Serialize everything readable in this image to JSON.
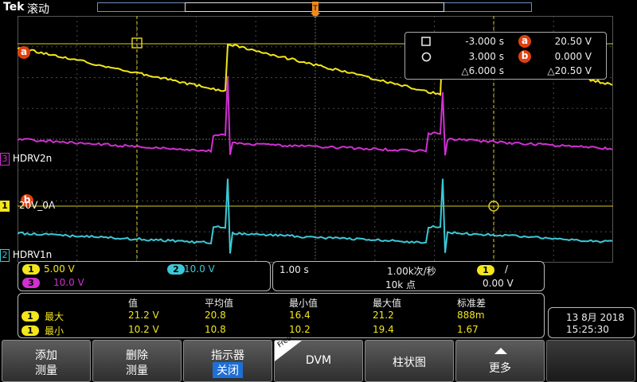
{
  "header": {
    "brand": "Tek",
    "mode": "滚动"
  },
  "channels": {
    "ch1_color": "#f3e61b",
    "ch2_color": "#3cc8d6",
    "ch3_color": "#d030d0",
    "cursor_color": "#e04010"
  },
  "waveform_labels": {
    "ch3_num": "3",
    "ch3_name": "HDRV2n",
    "ch1_num": "1",
    "ch1_name": "20V_0A",
    "ch2_num": "2",
    "ch2_name": "HDRV1n",
    "cursor_a": "a",
    "cursor_b": "b"
  },
  "cursor_readout": {
    "t1": "-3.000 s",
    "t2": "3.000 s",
    "dt": "△6.000 s",
    "a_marker": "a",
    "b_marker": "b",
    "va": "20.50 V",
    "vb": "0.000 V",
    "dv": "△20.50 V"
  },
  "scales": {
    "ch1_num": "1",
    "ch1_scale": "5.00 V",
    "ch2_num": "2",
    "ch2_scale": "10.0 V",
    "ch3_num": "3",
    "ch3_scale": "10.0 V"
  },
  "timebase": {
    "time_div": "1.00 s",
    "sample_rate": "1.00k次/秒",
    "record_length": "10k 点",
    "trigger_source": "1",
    "trigger_slope": "/",
    "trigger_level": "0.00 V"
  },
  "measurements": {
    "headers": [
      "值",
      "平均值",
      "最小值",
      "最大值",
      "标准差"
    ],
    "rows": [
      {
        "ch": "1",
        "name": "最大",
        "values": [
          "21.2 V",
          "20.8",
          "16.4",
          "21.2",
          "888m"
        ]
      },
      {
        "ch": "1",
        "name": "最小",
        "values": [
          "10.2 V",
          "10.8",
          "10.2",
          "19.4",
          "1.67"
        ]
      }
    ]
  },
  "datetime": {
    "date": "13 8月 2018",
    "time": "15:25:30"
  },
  "buttons": {
    "add_l1": "添加",
    "add_l2": "测量",
    "del_l1": "删除",
    "del_l2": "测量",
    "ind_l1": "指示器",
    "ind_l2": "关闭",
    "free_tag": "Free",
    "dvm": "DVM",
    "hist": "柱状图",
    "more": "更多"
  }
}
